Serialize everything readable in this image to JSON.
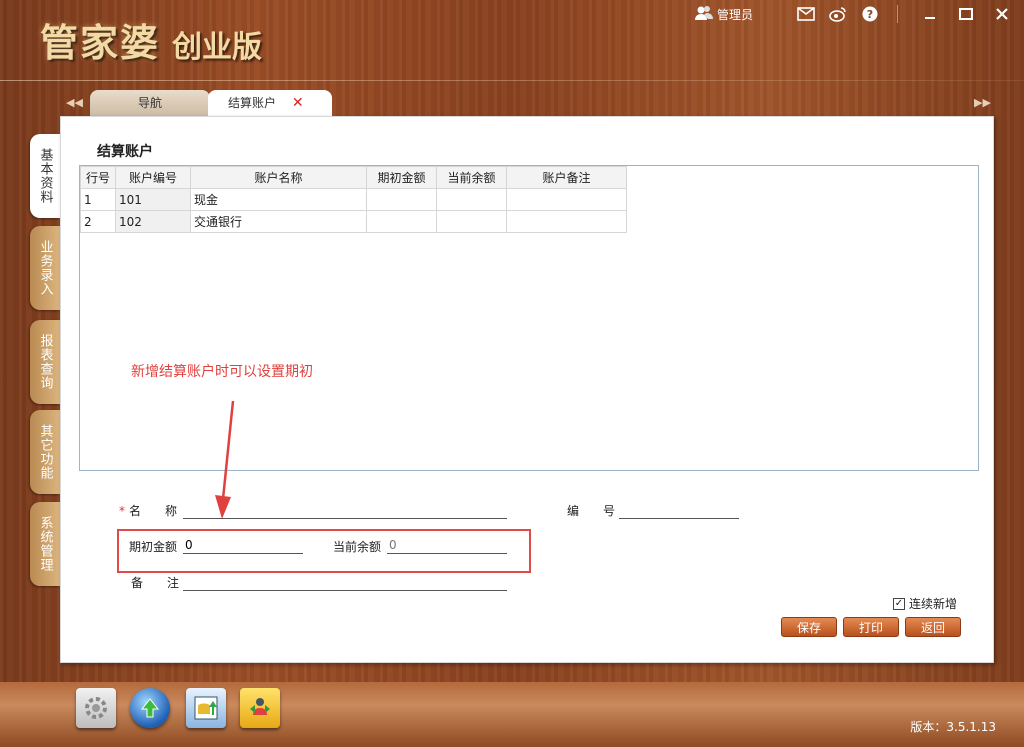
{
  "app": {
    "brand_main": "管家婆",
    "brand_sub": "创业版"
  },
  "topbar": {
    "user_label": "管理员"
  },
  "tabs": [
    {
      "label": "导航"
    },
    {
      "label": "结算账户"
    }
  ],
  "side_tabs": [
    {
      "label": "基本资料"
    },
    {
      "label": "业务录入"
    },
    {
      "label": "报表查询"
    },
    {
      "label": "其它功能"
    },
    {
      "label": "系统管理"
    }
  ],
  "panel": {
    "title": "结算账户"
  },
  "grid": {
    "headers": [
      "行号",
      "账户编号",
      "账户名称",
      "期初金额",
      "当前余额",
      "账户备注"
    ],
    "rows": [
      [
        "1",
        "101",
        "现金",
        "",
        "",
        ""
      ],
      [
        "2",
        "102",
        "交通银行",
        "",
        "",
        ""
      ]
    ]
  },
  "annotation": "新增结算账户时可以设置期初",
  "form": {
    "name_label": "名　　称",
    "name_value": "",
    "code_label": "编　　号",
    "code_value": "",
    "opening_label": "期初金额",
    "opening_value": "0",
    "balance_label": "当前余额",
    "balance_value": "0",
    "remark_label": "备　　注",
    "remark_value": "",
    "continuous_label": "连续新增",
    "continuous_checked": true
  },
  "buttons": {
    "save": "保存",
    "print": "打印",
    "back": "返回"
  },
  "footer": {
    "version": "版本：3.5.1.13"
  },
  "colors": {
    "accent_red": "#e0413f",
    "button_orange": "#d2703a",
    "wood": "#8a4220"
  }
}
